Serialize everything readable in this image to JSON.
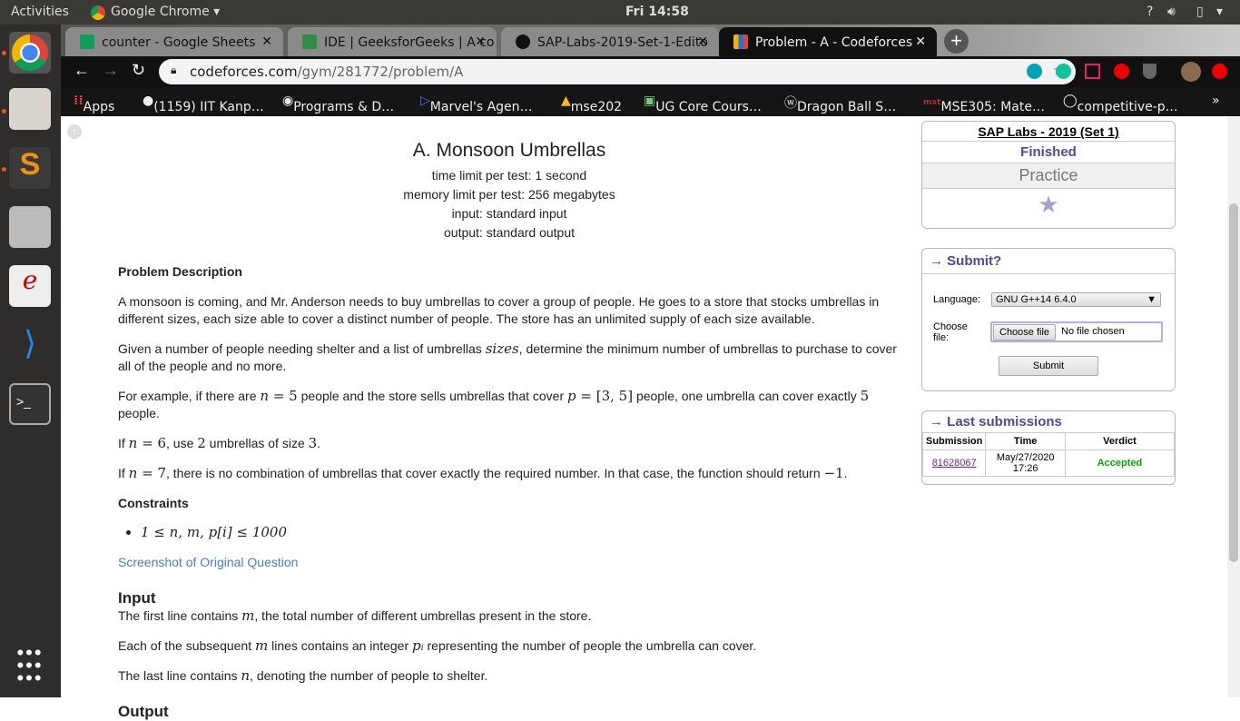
{
  "system": {
    "activities": "Activities",
    "app": "Google Chrome",
    "clock": "Fri 14:58",
    "help": "?"
  },
  "tabs": [
    {
      "title": "counter - Google Sheets",
      "color": "#0f9d58"
    },
    {
      "title": "IDE | GeeksforGeeks | A co",
      "color": "#2f8d46"
    },
    {
      "title": "SAP-Labs-2019-Set-1-Edito",
      "color": "#fff"
    },
    {
      "title": "Problem - A - Codeforces",
      "color": "#1a73e8",
      "active": true
    }
  ],
  "url": {
    "host": "codeforces.com",
    "path": "/gym/281772/problem/A"
  },
  "bookmarks": [
    "Apps",
    "(1159) IIT Kanp…",
    "Programs & D…",
    "Marvel's Agen…",
    "mse202",
    "UG Core Cours…",
    "Dragon Ball S…",
    "MSE305: Mate…",
    "competitive-p…",
    "»"
  ],
  "problem": {
    "title": "A. Monsoon Umbrellas",
    "time_limit": "time limit per test: 1 second",
    "memory_limit": "memory limit per test: 256 megabytes",
    "input": "input: standard input",
    "output": "output: standard output",
    "desc_head": "Problem Description",
    "p1": "A monsoon is coming, and Mr. Anderson needs to buy umbrellas to cover a group of people. He goes to a store that stocks umbrellas in different sizes, each size able to cover a distinct number of people. The store has an unlimited supply of each size available.",
    "p2a": "Given a number of people needing shelter and a list of umbrellas ",
    "p2m": "sizes",
    "p2b": ", determine the minimum number of umbrellas to purchase to cover all of the people and no more.",
    "p3a": "For example, if there are ",
    "p3m1": "n",
    "p3e1": " = 5",
    "p3b": " people and the store sells umbrellas that cover ",
    "p3m2": "p",
    "p3e2": " = [3, 5]",
    "p3c": " people, one umbrella can cover exactly ",
    "p3e3": "5",
    "p3d": " people.",
    "p4a": "If ",
    "p4m": "n",
    "p4e": " = 6",
    "p4b": ", use ",
    "p4e2": "2",
    "p4c": " umbrellas of size ",
    "p4e3": "3",
    "p4d": ".",
    "p5a": "If ",
    "p5m": "n",
    "p5e": " = 7",
    "p5b": ", there is no combination of umbrellas that cover exactly the required number. In that case, the function should return ",
    "p5e2": "−1",
    "p5c": ".",
    "constraints_head": "Constraints",
    "constraint": "1 ≤ n, m, p[i] ≤ 1000",
    "screenshot_link": "Screenshot of Original Question",
    "input_head": "Input",
    "in1a": "The first line contains ",
    "in1m": "m",
    "in1b": ", the total number of different umbrellas present in the store.",
    "in2a": "Each of the subsequent ",
    "in2m": "m",
    "in2b": " lines contains an integer ",
    "in2m2": "pᵢ",
    "in2c": " representing the number of people the umbrella can cover.",
    "in3a": "The last line contains ",
    "in3m": "n",
    "in3b": ", denoting the number of people to shelter.",
    "output_head": "Output"
  },
  "sidebar": {
    "contest": "SAP Labs - 2019 (Set 1)",
    "status": "Finished",
    "mode": "Practice",
    "submit_title": "→ Submit?",
    "language_label": "Language:",
    "language": "GNU G++14 6.4.0",
    "file_label": "Choose file:",
    "choose_file": "Choose file",
    "no_file": "No file chosen",
    "submit": "Submit",
    "last_title": "→ Last submissions",
    "cols": [
      "Submission",
      "Time",
      "Verdict"
    ],
    "row": {
      "id": "81628067",
      "time": "May/27/2020 17:26",
      "verdict": "Accepted"
    }
  }
}
